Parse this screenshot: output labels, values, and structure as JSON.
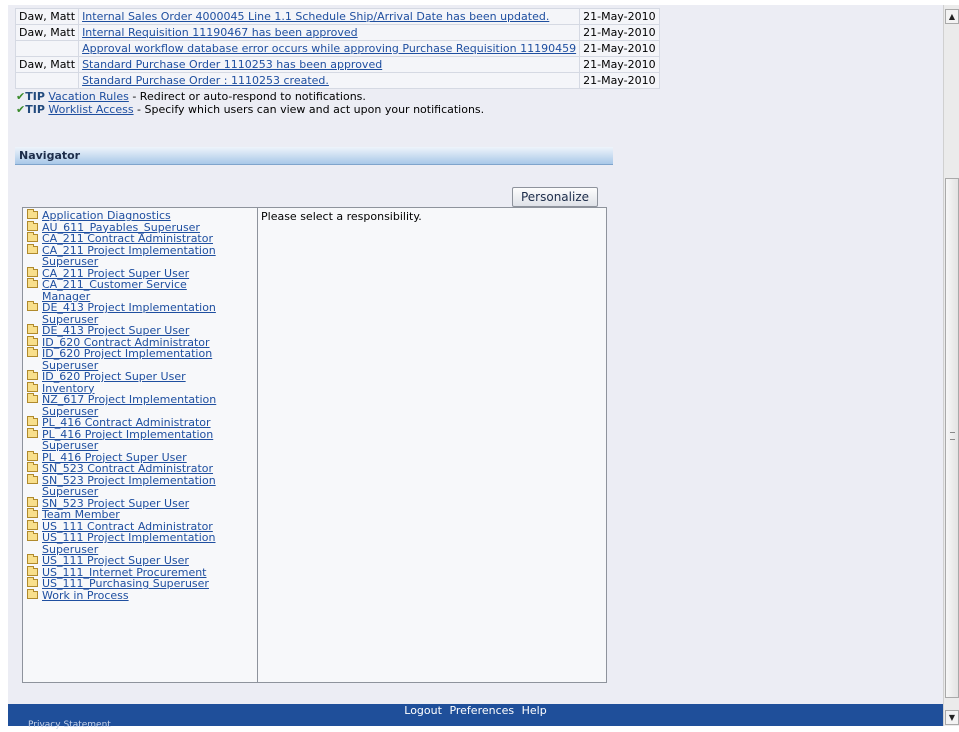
{
  "notifications": [
    {
      "from": "Daw, Matt",
      "subject": "Internal Sales Order 4000045 Line 1.1 Schedule Ship/Arrival Date has been updated.",
      "date": "21-May-2010"
    },
    {
      "from": "Daw, Matt",
      "subject": "Internal Requisition 11190467 has been approved",
      "date": "21-May-2010"
    },
    {
      "from": "",
      "subject": "Approval workflow database error occurs while approving Purchase Requisition 11190459",
      "date": "21-May-2010"
    },
    {
      "from": "Daw, Matt",
      "subject": "Standard Purchase Order 1110253 has been approved",
      "date": "21-May-2010"
    },
    {
      "from": "",
      "subject": "Standard Purchase Order : 1110253 created.",
      "date": "21-May-2010"
    }
  ],
  "tips": [
    {
      "check": "✔",
      "label": "TIP",
      "link": "Vacation Rules",
      "text": " - Redirect or auto-respond to notifications."
    },
    {
      "check": "✔",
      "label": "TIP",
      "link": "Worklist Access",
      "text": " - Specify which users can view and act upon your notifications."
    }
  ],
  "navigator": {
    "title": "Navigator",
    "personalize_label": "Personalize",
    "message": "Please select a responsibility.",
    "responsibilities": [
      "Application Diagnostics",
      "AU_611_Payables_Superuser",
      "CA_211 Contract Administrator",
      "CA_211 Project Implementation Superuser",
      "CA_211 Project Super User",
      "CA_211_Customer Service Manager",
      "DE_413 Project Implementation Superuser",
      "DE_413 Project Super User",
      "ID_620 Contract Administrator",
      "ID_620 Project Implementation Superuser",
      "ID_620 Project Super User",
      "Inventory",
      "NZ_617 Project Implementation Superuser",
      "PL_416 Contract Administrator",
      "PL_416 Project Implementation Superuser",
      "PL_416 Project Super User",
      "SN_523 Contract Administrator",
      "SN_523 Project Implementation Superuser",
      "SN_523 Project Super User",
      "Team Member",
      "US_111 Contract Administrator",
      "US_111 Project Implementation Superuser",
      "US_111 Project Super User",
      "US_111_Internet Procurement",
      "US_111_Purchasing Superuser",
      "Work in Process"
    ]
  },
  "footer": {
    "links": [
      "Logout",
      "Preferences",
      "Help"
    ],
    "sub": "Privacy Statement"
  },
  "icons": {
    "folder": "folder-icon",
    "check": "check-icon",
    "scroll_up": "scroll-up-icon",
    "scroll_down": "scroll-down-icon"
  },
  "colors": {
    "link": "#1f4fa0",
    "footer": "#1f4f9a",
    "header": "#a9c8e8"
  }
}
